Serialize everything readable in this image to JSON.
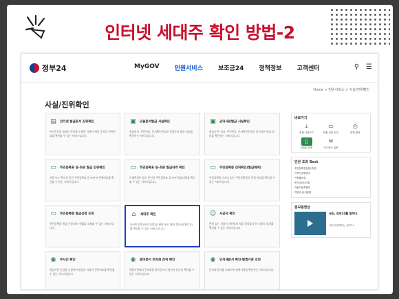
{
  "headline": "인터넷 세대주 확인 방법-2",
  "site": {
    "logo_text": "정부24",
    "menu": [
      {
        "label": "MyGOV",
        "active": false
      },
      {
        "label": "민원서비스",
        "active": true
      },
      {
        "label": "보조금24",
        "active": false
      },
      {
        "label": "정책정보",
        "active": false
      },
      {
        "label": "고객센터",
        "active": false
      }
    ],
    "breadcrumb": "Home  >  민원서비스  >  사실/진위확인",
    "page_title": "사실/진위확인"
  },
  "tiles": [
    {
      "icon": "document-icon",
      "glyph": "▤",
      "name": "인터넷 발급문서 진위확인",
      "desc": "온라인으로 발급한 문서를 수령한 기관이 해당 문서의 진위여부를 확인할 수 있는 서비스입니다."
    },
    {
      "icon": "certificate-icon",
      "glyph": "▣",
      "name": "민원문서발급 사실확인",
      "desc": "발급일자, 주민번호, 문서확인번호로 민원문서 발급 사실을 확인하는 서비스입니다."
    },
    {
      "icon": "certificate-icon",
      "glyph": "▣",
      "name": "공익사본발급 사실확인",
      "desc": "발급기관, 일자, 주민번호, 문서확인번호로 공익사본 발급 사실을 확인하는 서비스입니다."
    },
    {
      "icon": "id-card-icon",
      "glyph": "▭",
      "name": "주민등록표 등·초본 발급 진위확인",
      "desc": "서면 또는 팩스로 받은 주민등록표 등·초본의 진위여부를 확인할 수 있는 서비스입니다."
    },
    {
      "icon": "id-card-icon",
      "glyph": "▭",
      "name": "주민등록표 등·초본 발급내역 확인",
      "desc": "이해관계인 등이 본인의 주민등록표 등·초본 발급내역을 확인할 수 있는 서비스입니다."
    },
    {
      "icon": "id-card-icon",
      "glyph": "▭",
      "name": "주민등록증 진위확인(발급체계)",
      "desc": "주민등록증 가지고 있는 주민등록증의 진위 여부를 확인할 수 있는 서비스입니다."
    },
    {
      "icon": "id-card-icon",
      "glyph": "▭",
      "name": "주민등록증 발급신청 조회",
      "desc": "주민등록증 발급 신청 처리 현황을 조회할 수 있는 서비스입니다."
    },
    {
      "icon": "home-icon",
      "glyph": "⌂",
      "name": "세대주 확인",
      "desc": "온라인 민원(사전 신청)을 위한 본인 세대 정보(세대주 등)를 확인할 수 있는 서비스입니다.",
      "highlight": true
    },
    {
      "icon": "people-icon",
      "glyph": "☺",
      "name": "사공자 확인",
      "desc": "관계 있는 사람의 개인정보 제공 동의를 받아 사망자 정보를 확인할 수 있는 서비스입니다."
    },
    {
      "icon": "stamp-icon",
      "glyph": "◉",
      "name": "부사인 확인",
      "desc": "발급기관 인감을 신청하여 발급한 서류의 진위여부를 확인할 수 있는 서비스입니다."
    },
    {
      "icon": "stamp-icon",
      "glyph": "◉",
      "name": "종이문서 전자화 진위 확인",
      "desc": "행정기관에서 전자화한 종이문서가 원본과 같은지 확인할 수 있는 서비스입니다."
    },
    {
      "icon": "stamp-icon",
      "glyph": "◉",
      "name": "인지세문서 확인·발행기관 조회",
      "desc": "인지세 문서를 조회하여 발행기관을 확인하는 서비스입니다."
    }
  ],
  "sidebar": {
    "quick_title": "바로가기",
    "quick": [
      {
        "icon": "download-icon",
        "glyph": "⤓",
        "label": "민원 다운로드",
        "selected": false
      },
      {
        "icon": "monitor-icon",
        "glyph": "▭",
        "label": "민원 신청 안내",
        "selected": false
      },
      {
        "icon": "print-icon",
        "glyph": "⎙",
        "label": "민원 출력",
        "selected": false
      },
      {
        "icon": "phone-icon",
        "glyph": "▯",
        "label": "모바일 민원",
        "selected": true
      },
      {
        "icon": "chat-icon",
        "glyph": "✉",
        "label": "자주하는 질문",
        "selected": false
      }
    ],
    "best_title": "민원 조회 Best",
    "best": [
      "주민등록표등본(초본)",
      "가족관계증명서",
      "건축물대장",
      "토지(임야)대장",
      "자동차등록원부",
      "지방세 납세증명"
    ],
    "promo_title": "홍보동영상",
    "promo_headline": "국민, 정부24를 말하다.",
    "promo_desc": "국민과 함께하는 정부24"
  }
}
